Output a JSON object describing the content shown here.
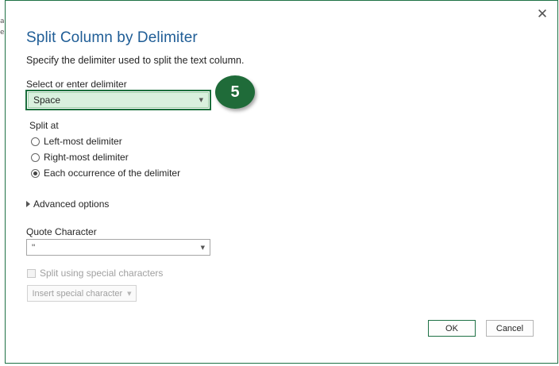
{
  "dialog": {
    "title": "Split Column by Delimiter",
    "subtitle": "Specify the delimiter used to split the text column.",
    "close_glyph": "✕"
  },
  "delimiter": {
    "label": "Select or enter delimiter",
    "value": "Space",
    "highlight_color": "#1b6e3c"
  },
  "badge": {
    "text": "5",
    "color": "#1f6b39"
  },
  "split_at": {
    "label": "Split at",
    "options": [
      {
        "label": "Left-most delimiter",
        "checked": false
      },
      {
        "label": "Right-most delimiter",
        "checked": false
      },
      {
        "label": "Each occurrence of the delimiter",
        "checked": true
      }
    ]
  },
  "advanced": {
    "label": "Advanced options"
  },
  "quote": {
    "label": "Quote Character",
    "value": "\""
  },
  "special": {
    "checkbox_label": "Split using special characters",
    "insert_label": "Insert special character"
  },
  "buttons": {
    "ok": "OK",
    "cancel": "Cancel"
  }
}
